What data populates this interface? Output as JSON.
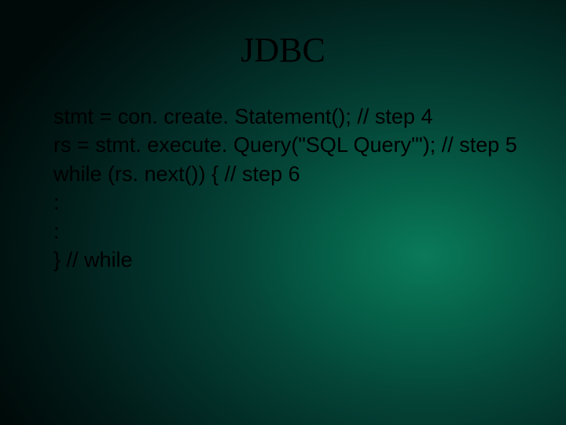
{
  "title": "JDBC",
  "lines": [
    "stmt = con. create. Statement();  // step 4",
    "rs = stmt. execute. Query(\"SQL Query'\"); // step 5",
    "while (rs. next()) {  // step 6",
    ":",
    ":",
    "} // while"
  ]
}
